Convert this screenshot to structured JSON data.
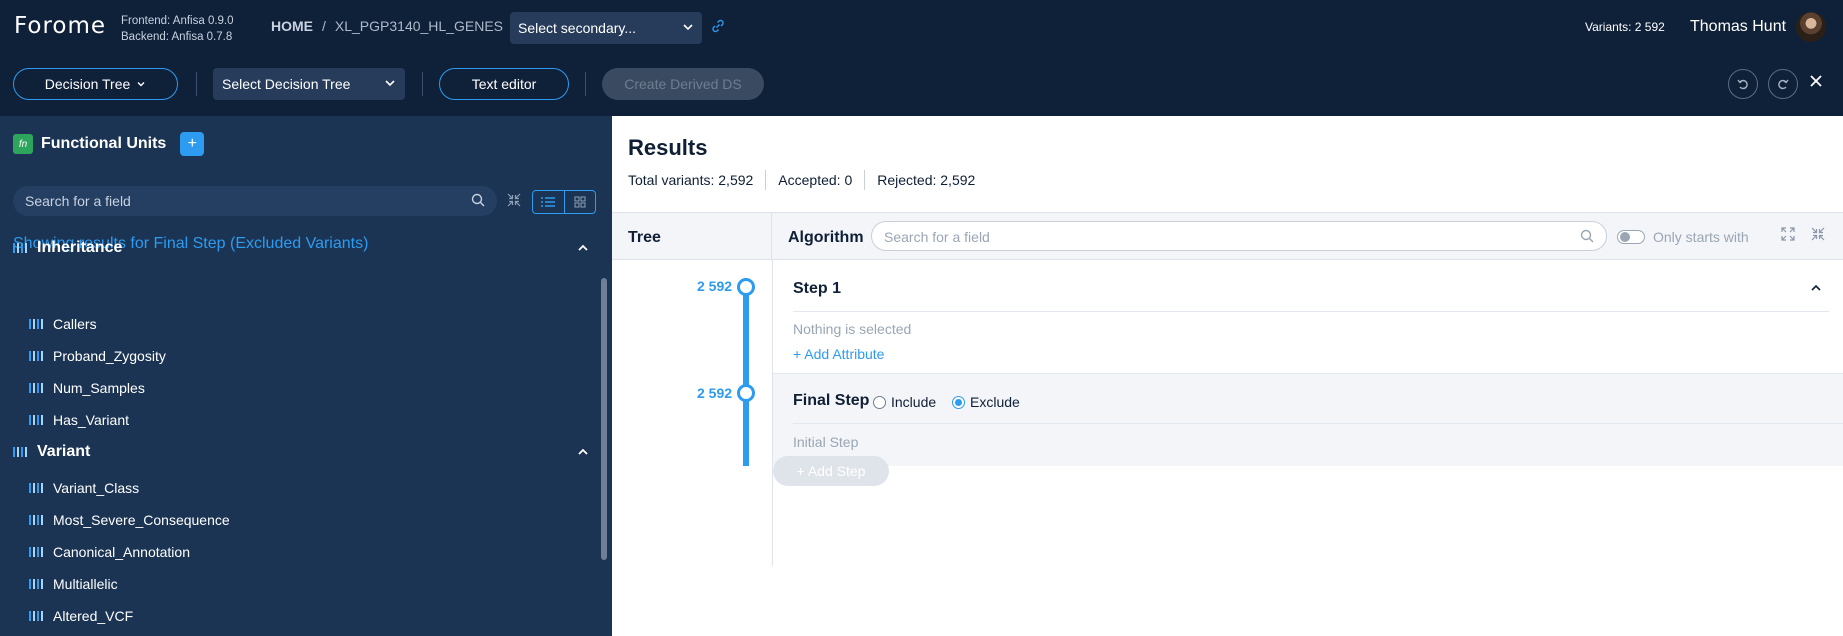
{
  "header": {
    "logo": "Forome",
    "frontend_version": "Frontend: Anfisa 0.9.0",
    "backend_version": "Backend: Anfisa 0.7.8",
    "breadcrumbs": [
      "HOME",
      "/",
      "XL_PGP3140_HL_GENES",
      "/"
    ],
    "secondary_select": "Select secondary...",
    "variants": "Variants: 2 592",
    "user": "Thomas Hunt"
  },
  "toolbar": {
    "decision_tree_btn": "Decision Tree",
    "select_tree": "Select Decision Tree",
    "text_editor": "Text editor",
    "create_derived": "Create Derived DS"
  },
  "sidebar": {
    "fn_badge": "fn",
    "title": "Functional Units",
    "add": "+",
    "search_placeholder": "Search for a field",
    "showing": "Showing results for Final Step (Excluded Variants)",
    "groups": [
      {
        "title": "Inheritance",
        "items": [
          "Callers",
          "Proband_Zygosity",
          "Num_Samples",
          "Has_Variant"
        ]
      },
      {
        "title": "Variant",
        "items": [
          "Variant_Class",
          "Most_Severe_Consequence",
          "Canonical_Annotation",
          "Multiallelic",
          "Altered_VCF"
        ]
      }
    ]
  },
  "results": {
    "title": "Results",
    "total": "Total variants: 2,592",
    "accepted": "Accepted: 0",
    "rejected": "Rejected: 2,592"
  },
  "tree_panel": {
    "tree_label": "Tree",
    "algorithm_label": "Algorithm",
    "search_placeholder": "Search for a field",
    "only_starts": "Only starts with",
    "steps": [
      {
        "count": "2 592",
        "title": "Step 1",
        "body": "Nothing is selected",
        "action": "+ Add Attribute"
      },
      {
        "count": "2 592",
        "title": "Final Step",
        "include": "Include",
        "exclude": "Exclude",
        "body": "Initial Step"
      }
    ],
    "add_step": "+ Add Step"
  }
}
